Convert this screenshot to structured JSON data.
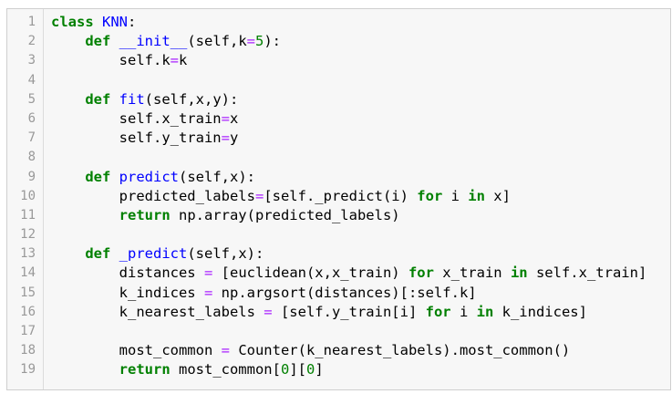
{
  "editor": {
    "lines": [
      {
        "n": "1",
        "tokens": [
          [
            "kw",
            "class"
          ],
          [
            "t",
            " "
          ],
          [
            "def",
            "KNN"
          ],
          [
            "t",
            ":"
          ]
        ]
      },
      {
        "n": "2",
        "tokens": [
          [
            "t",
            "    "
          ],
          [
            "kw",
            "def"
          ],
          [
            "t",
            " "
          ],
          [
            "def",
            "__init__"
          ],
          [
            "t",
            "(self,k"
          ],
          [
            "op",
            "="
          ],
          [
            "num",
            "5"
          ],
          [
            "t",
            "):"
          ]
        ]
      },
      {
        "n": "3",
        "tokens": [
          [
            "t",
            "        self.k"
          ],
          [
            "op",
            "="
          ],
          [
            "t",
            "k"
          ]
        ]
      },
      {
        "n": "4",
        "tokens": []
      },
      {
        "n": "5",
        "tokens": [
          [
            "t",
            "    "
          ],
          [
            "kw",
            "def"
          ],
          [
            "t",
            " "
          ],
          [
            "def",
            "fit"
          ],
          [
            "t",
            "(self,x,y):"
          ]
        ]
      },
      {
        "n": "6",
        "tokens": [
          [
            "t",
            "        self.x_train"
          ],
          [
            "op",
            "="
          ],
          [
            "t",
            "x"
          ]
        ]
      },
      {
        "n": "7",
        "tokens": [
          [
            "t",
            "        self.y_train"
          ],
          [
            "op",
            "="
          ],
          [
            "t",
            "y"
          ]
        ]
      },
      {
        "n": "8",
        "tokens": []
      },
      {
        "n": "9",
        "tokens": [
          [
            "t",
            "    "
          ],
          [
            "kw",
            "def"
          ],
          [
            "t",
            " "
          ],
          [
            "def",
            "predict"
          ],
          [
            "t",
            "(self,x):"
          ]
        ]
      },
      {
        "n": "10",
        "tokens": [
          [
            "t",
            "        predicted_labels"
          ],
          [
            "op",
            "="
          ],
          [
            "t",
            "[self._predict(i) "
          ],
          [
            "kw",
            "for"
          ],
          [
            "t",
            " i "
          ],
          [
            "kw",
            "in"
          ],
          [
            "t",
            " x]"
          ]
        ]
      },
      {
        "n": "11",
        "tokens": [
          [
            "t",
            "        "
          ],
          [
            "kw",
            "return"
          ],
          [
            "t",
            " np.array(predicted_labels)"
          ]
        ]
      },
      {
        "n": "12",
        "tokens": []
      },
      {
        "n": "13",
        "tokens": [
          [
            "t",
            "    "
          ],
          [
            "kw",
            "def"
          ],
          [
            "t",
            " "
          ],
          [
            "def",
            "_predict"
          ],
          [
            "t",
            "(self,x):"
          ]
        ]
      },
      {
        "n": "14",
        "tokens": [
          [
            "t",
            "        distances "
          ],
          [
            "op",
            "="
          ],
          [
            "t",
            " [euclidean(x,x_train) "
          ],
          [
            "kw",
            "for"
          ],
          [
            "t",
            " x_train "
          ],
          [
            "kw",
            "in"
          ],
          [
            "t",
            " self.x_train]"
          ]
        ]
      },
      {
        "n": "15",
        "tokens": [
          [
            "t",
            "        k_indices "
          ],
          [
            "op",
            "="
          ],
          [
            "t",
            " np.argsort(distances)[:self.k]"
          ]
        ]
      },
      {
        "n": "16",
        "tokens": [
          [
            "t",
            "        k_nearest_labels "
          ],
          [
            "op",
            "="
          ],
          [
            "t",
            " [self.y_train[i] "
          ],
          [
            "kw",
            "for"
          ],
          [
            "t",
            " i "
          ],
          [
            "kw",
            "in"
          ],
          [
            "t",
            " k_indices]"
          ]
        ]
      },
      {
        "n": "17",
        "tokens": []
      },
      {
        "n": "18",
        "tokens": [
          [
            "t",
            "        most_common "
          ],
          [
            "op",
            "="
          ],
          [
            "t",
            " Counter(k_nearest_labels).most_common()"
          ]
        ]
      },
      {
        "n": "19",
        "tokens": [
          [
            "t",
            "        "
          ],
          [
            "kw",
            "return"
          ],
          [
            "t",
            " most_common["
          ],
          [
            "num",
            "0"
          ],
          [
            "t",
            "]["
          ],
          [
            "num",
            "0"
          ],
          [
            "t",
            "]"
          ]
        ]
      }
    ],
    "colors": {
      "keyword": "#008000",
      "definition": "#0000ff",
      "operator": "#aa22ff",
      "number": "#008000",
      "line_number": "#999999",
      "background": "#f7f7f7",
      "border": "#cfcfcf"
    }
  }
}
